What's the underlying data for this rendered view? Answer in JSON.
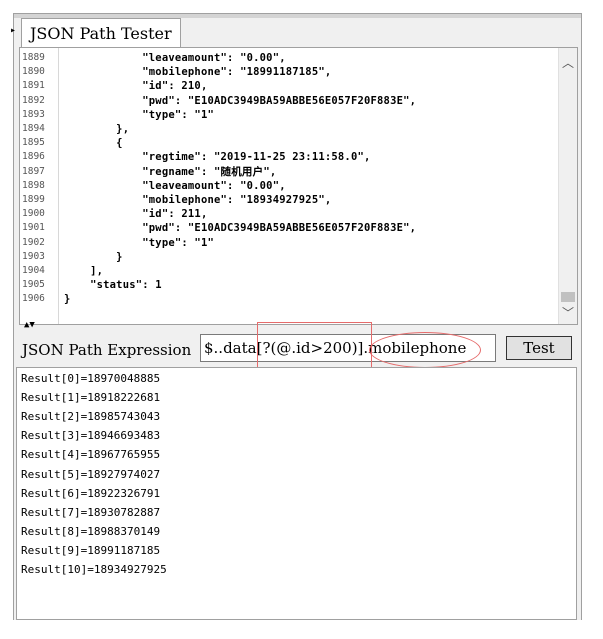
{
  "tab": {
    "title": "JSON Path Tester"
  },
  "editor": {
    "lines": [
      {
        "num": "1889",
        "code": "            \"leaveamount\": \"0.00\","
      },
      {
        "num": "1890",
        "code": "            \"mobilephone\": \"18991187185\","
      },
      {
        "num": "1891",
        "code": "            \"id\": 210,"
      },
      {
        "num": "1892",
        "code": "            \"pwd\": \"E10ADC3949BA59ABBE56E057F20F883E\","
      },
      {
        "num": "1893",
        "code": "            \"type\": \"1\""
      },
      {
        "num": "1894",
        "code": "        },"
      },
      {
        "num": "1895",
        "code": "        {"
      },
      {
        "num": "1896",
        "code": "            \"regtime\": \"2019-11-25 23:11:58.0\","
      },
      {
        "num": "1897",
        "code": "            \"regname\": \"随机用户\","
      },
      {
        "num": "1898",
        "code": "            \"leaveamount\": \"0.00\","
      },
      {
        "num": "1899",
        "code": "            \"mobilephone\": \"18934927925\","
      },
      {
        "num": "1900",
        "code": "            \"id\": 211,"
      },
      {
        "num": "1901",
        "code": "            \"pwd\": \"E10ADC3949BA59ABBE56E057F20F883E\","
      },
      {
        "num": "1902",
        "code": "            \"type\": \"1\""
      },
      {
        "num": "1903",
        "code": "        }"
      },
      {
        "num": "1904",
        "code": "    ],"
      },
      {
        "num": "1905",
        "code": "    \"status\": 1"
      },
      {
        "num": "1906",
        "code": "}"
      }
    ]
  },
  "expression": {
    "label": "JSON Path Expression",
    "value": "$..data[?(@.id>200)].mobilephone"
  },
  "test_button": {
    "label": "Test"
  },
  "results": [
    "Result[0]=18970048885",
    "Result[1]=18918222681",
    "Result[2]=18985743043",
    "Result[3]=18946693483",
    "Result[4]=18967765955",
    "Result[5]=18927974027",
    "Result[6]=18922326791",
    "Result[7]=18930782887",
    "Result[8]=18988370149",
    "Result[9]=18991187185",
    "Result[10]=18934927925"
  ],
  "icons": {
    "scroll_up": "chevron-up-icon",
    "scroll_down": "chevron-down-icon"
  },
  "colors": {
    "annotation": "#e56b6b"
  }
}
